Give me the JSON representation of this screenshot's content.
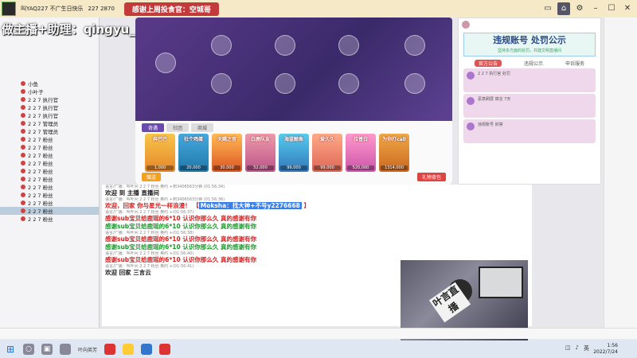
{
  "titlebar": {
    "app_text": "叫YAQ227 不广生日快乐",
    "stats": "227  2870",
    "banner": "感谢上周投食官：空城哥"
  },
  "overlay_text": "做主播+助理：qingyu_101367",
  "left_list": {
    "rows": [
      "小鱼",
      "小叶子",
      "2 2 7 执行官",
      "2 2 7 执行官",
      "2 2 7 执行官",
      "2 2 7 管理员",
      "2 2 7 管理员",
      "2 2 7 粉丝",
      "2 2 7 粉丝",
      "2 2 7 粉丝",
      "2 2 7 粉丝",
      "2 2 7 粉丝",
      "2 2 7 粉丝",
      "2 2 7 粉丝",
      "2 2 7 粉丝",
      "2 2 7 粉丝",
      "2 2 7 粉丝",
      "2 2 7 粉丝"
    ]
  },
  "game": {
    "tabs": [
      "奇遇",
      "社团",
      "商城"
    ],
    "cards": [
      {
        "name": "奔巴巴",
        "price": "1,000"
      },
      {
        "name": "社个鸡蛋",
        "price": "20,000"
      },
      {
        "name": "天赐之音",
        "price": "30,000"
      },
      {
        "name": "白鹿队友",
        "price": "52,000"
      },
      {
        "name": "海蓝鲸鱼",
        "price": "99,000"
      },
      {
        "name": "爱久久",
        "price": "99,000"
      },
      {
        "name": "拉普白",
        "price": "520,000"
      },
      {
        "name": "为你打call",
        "price": "1314,000"
      }
    ],
    "footer_send": "赠送",
    "footer_gift": "礼物背包"
  },
  "right_panel": {
    "violation_title": "违规账号 处罚公示",
    "violation_sub": "坚持多方面的处罚，共建文明直播间",
    "tabs": [
      "官方公告",
      "违规公示",
      "申诉服务"
    ],
    "entries": [
      "2 2 7 执行官 处罚",
      "恶意刷屏 禁言 7天",
      "违规账号 封禁"
    ]
  },
  "chat": {
    "messages": [
      {
        "meta": "语言/广播：叫叶问 2 2 7 粉丝 奥约 +到3406563分钟 (01:56:34)",
        "text": "欢迎 到 主播 直播间",
        "style": "black"
      },
      {
        "meta": "语言/广播：叫叶问 2 2 7 粉丝 奥约 +到3406563分钟 (01:56:36)",
        "text": "欢迎，回家 你与星光一样浪漫！ 【",
        "hl": "Moksha：找大神+不号y2276668",
        "tail": " 】",
        "style": "red"
      },
      {
        "meta": "语言/广播：叫叶问 2 2 7 粉丝 奥约 +(01:56:37)",
        "text": "感谢sub宝贝给鹿瑶的6*10 认识你那么久 真的感谢有你",
        "style": "red"
      },
      {
        "meta": "",
        "text": "感谢sub宝贝给鹿瑶的6*10 认识你那么久 真的感谢有你",
        "style": "green"
      },
      {
        "meta": "语言/广播：叫叶问 2 2 7 粉丝 奥约 +(01:56:38)",
        "text": "感谢sub宝贝给鹿瑶的6*10 认识你那么久 真的感谢有你",
        "style": "red"
      },
      {
        "meta": "",
        "text": "感谢sub宝贝给鹿瑶的6*10 认识你那么久 真的感谢有你",
        "style": "green"
      },
      {
        "meta": "语言/广播：叫叶问 2 2 7 粉丝 奥约 +(01:56:40)",
        "text": "感谢sub宝贝给鹿瑶的6*10 认识你那么久 真的感谢有你",
        "style": "red"
      },
      {
        "meta": "语言/广播：叫叶问 2 2 7 粉丝 奥约 +(01:56:41)",
        "text": "欢迎 回家 三言云",
        "style": "black"
      }
    ]
  },
  "cam": {
    "sign_text": "叶言直播"
  },
  "taskbar": {
    "app_label": "叶向英芳",
    "tray_lang": "英",
    "time": "1:56",
    "date": "2022/7/24"
  }
}
